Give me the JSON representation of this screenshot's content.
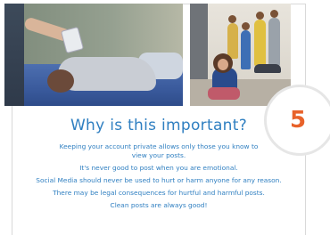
{
  "slide": {
    "number": "5",
    "title": "Why is this important?",
    "points": [
      "Keeping your account private allows only those you know to view your posts.",
      "It's never good to post when you are emotional.",
      "Social Media should never be used to hurt or harm anyone for any reason.",
      "There may be legal consequences for hurtful and harmful posts.",
      "Clean posts are always good!"
    ]
  },
  "colors": {
    "title": "#2f7fc1",
    "text": "#2f7fc1",
    "number": "#e8622a"
  }
}
